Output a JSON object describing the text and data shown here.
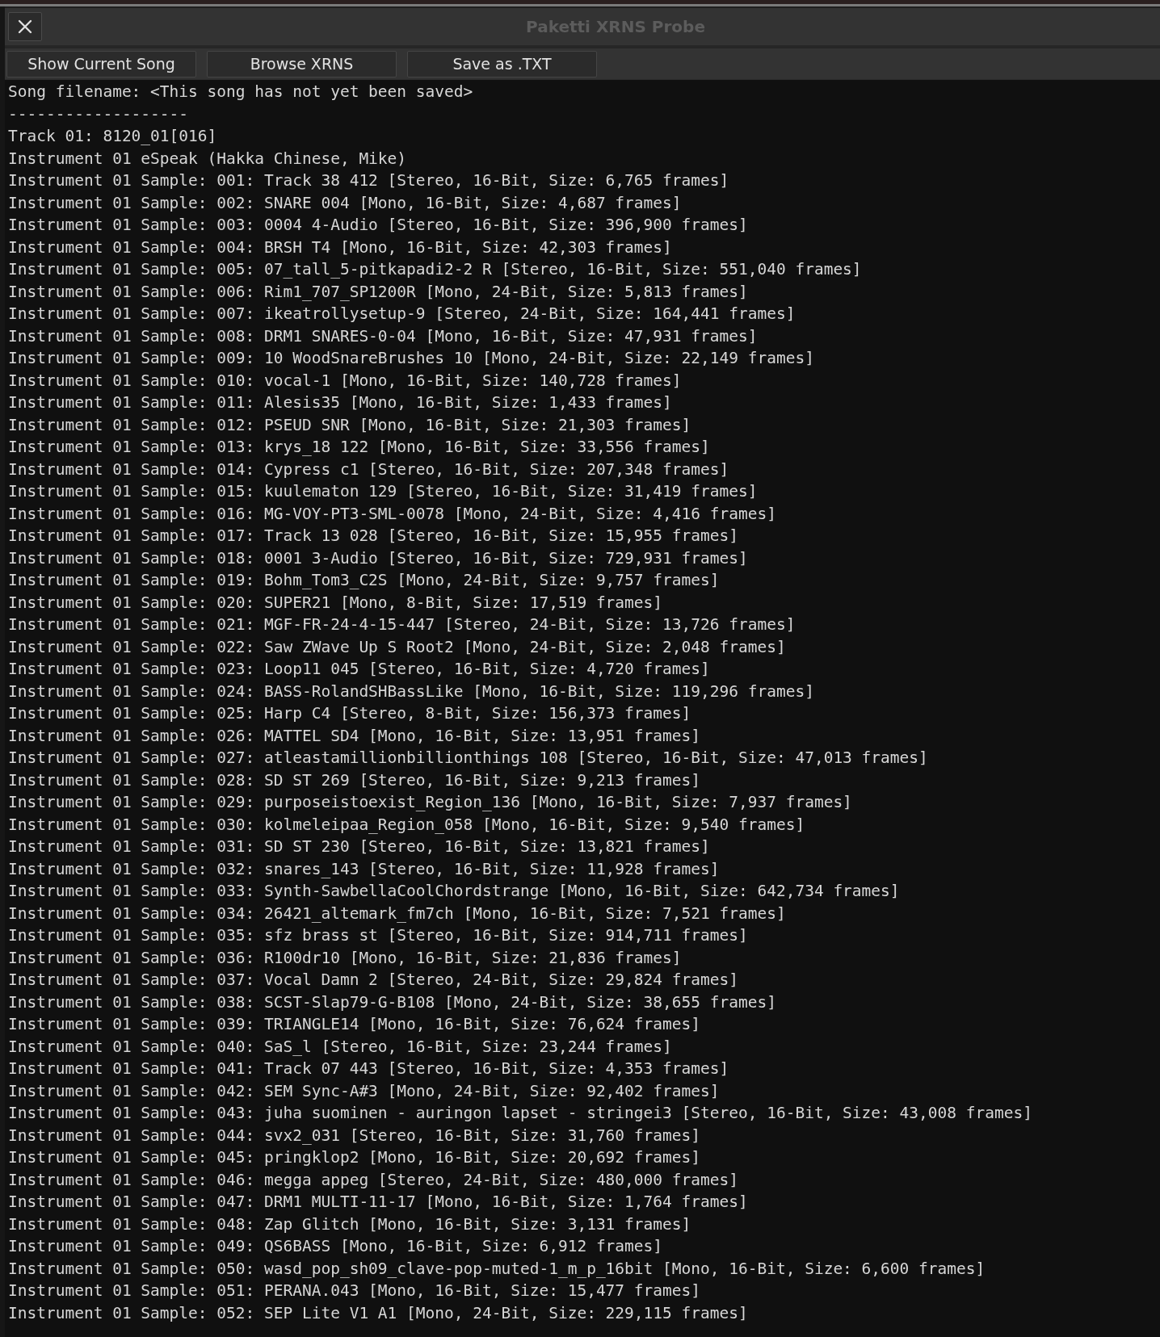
{
  "window": {
    "title": "Paketti XRNS Probe"
  },
  "buttons": [
    "Show Current Song",
    "Browse XRNS",
    "Save as .TXT"
  ],
  "output": {
    "lines": [
      "Song filename: <This song has not yet been saved>",
      "-------------------",
      "Track 01: 8120_01[016]",
      "Instrument 01 eSpeak (Hakka Chinese, Mike)",
      "Instrument 01 Sample: 001: Track 38 412 [Stereo, 16-Bit, Size: 6,765 frames]",
      "Instrument 01 Sample: 002: SNARE 004 [Mono, 16-Bit, Size: 4,687 frames]",
      "Instrument 01 Sample: 003: 0004 4-Audio [Stereo, 16-Bit, Size: 396,900 frames]",
      "Instrument 01 Sample: 004: BRSH T4 [Mono, 16-Bit, Size: 42,303 frames]",
      "Instrument 01 Sample: 005: 07_tall_5-pitkapadi2-2 R [Stereo, 16-Bit, Size: 551,040 frames]",
      "Instrument 01 Sample: 006: Rim1_707_SP1200R [Mono, 24-Bit, Size: 5,813 frames]",
      "Instrument 01 Sample: 007: ikeatrollysetup-9 [Stereo, 24-Bit, Size: 164,441 frames]",
      "Instrument 01 Sample: 008: DRM1 SNARES-0-04 [Mono, 16-Bit, Size: 47,931 frames]",
      "Instrument 01 Sample: 009: 10 WoodSnareBrushes 10 [Mono, 24-Bit, Size: 22,149 frames]",
      "Instrument 01 Sample: 010: vocal-1 [Mono, 16-Bit, Size: 140,728 frames]",
      "Instrument 01 Sample: 011: Alesis35 [Mono, 16-Bit, Size: 1,433 frames]",
      "Instrument 01 Sample: 012: PSEUD SNR [Mono, 16-Bit, Size: 21,303 frames]",
      "Instrument 01 Sample: 013: krys_18 122 [Mono, 16-Bit, Size: 33,556 frames]",
      "Instrument 01 Sample: 014: Cypress c1 [Stereo, 16-Bit, Size: 207,348 frames]",
      "Instrument 01 Sample: 015: kuulematon 129 [Stereo, 16-Bit, Size: 31,419 frames]",
      "Instrument 01 Sample: 016: MG-VOY-PT3-SML-0078 [Mono, 24-Bit, Size: 4,416 frames]",
      "Instrument 01 Sample: 017: Track 13 028 [Stereo, 16-Bit, Size: 15,955 frames]",
      "Instrument 01 Sample: 018: 0001 3-Audio [Stereo, 16-Bit, Size: 729,931 frames]",
      "Instrument 01 Sample: 019: Bohm_Tom3_C2S [Mono, 24-Bit, Size: 9,757 frames]",
      "Instrument 01 Sample: 020: SUPER21 [Mono, 8-Bit, Size: 17,519 frames]",
      "Instrument 01 Sample: 021: MGF-FR-24-4-15-447 [Stereo, 24-Bit, Size: 13,726 frames]",
      "Instrument 01 Sample: 022: Saw ZWave Up S Root2 [Mono, 24-Bit, Size: 2,048 frames]",
      "Instrument 01 Sample: 023: Loop11 045 [Stereo, 16-Bit, Size: 4,720 frames]",
      "Instrument 01 Sample: 024: BASS-RolandSHBassLike [Mono, 16-Bit, Size: 119,296 frames]",
      "Instrument 01 Sample: 025: Harp C4 [Stereo, 8-Bit, Size: 156,373 frames]",
      "Instrument 01 Sample: 026: MATTEL SD4 [Mono, 16-Bit, Size: 13,951 frames]",
      "Instrument 01 Sample: 027: atleastamillionbillionthings 108 [Stereo, 16-Bit, Size: 47,013 frames]",
      "Instrument 01 Sample: 028: SD ST 269 [Stereo, 16-Bit, Size: 9,213 frames]",
      "Instrument 01 Sample: 029: purposeistoexist_Region_136 [Mono, 16-Bit, Size: 7,937 frames]",
      "Instrument 01 Sample: 030: kolmeleipaa_Region_058 [Mono, 16-Bit, Size: 9,540 frames]",
      "Instrument 01 Sample: 031: SD ST 230 [Stereo, 16-Bit, Size: 13,821 frames]",
      "Instrument 01 Sample: 032: snares_143 [Stereo, 16-Bit, Size: 11,928 frames]",
      "Instrument 01 Sample: 033: Synth-SawbellaCoolChordstrange [Mono, 16-Bit, Size: 642,734 frames]",
      "Instrument 01 Sample: 034: 26421_altemark_fm7ch [Mono, 16-Bit, Size: 7,521 frames]",
      "Instrument 01 Sample: 035: sfz brass st [Stereo, 16-Bit, Size: 914,711 frames]",
      "Instrument 01 Sample: 036: R100dr10 [Mono, 16-Bit, Size: 21,836 frames]",
      "Instrument 01 Sample: 037: Vocal Damn 2 [Stereo, 24-Bit, Size: 29,824 frames]",
      "Instrument 01 Sample: 038: SCST-Slap79-G-B108 [Mono, 24-Bit, Size: 38,655 frames]",
      "Instrument 01 Sample: 039: TRIANGLE14 [Mono, 16-Bit, Size: 76,624 frames]",
      "Instrument 01 Sample: 040: SaS_l [Stereo, 16-Bit, Size: 23,244 frames]",
      "Instrument 01 Sample: 041: Track 07 443 [Stereo, 16-Bit, Size: 4,353 frames]",
      "Instrument 01 Sample: 042: SEM Sync-A#3 [Mono, 24-Bit, Size: 92,402 frames]",
      "Instrument 01 Sample: 043: juha suominen - auringon lapset - stringei3 [Stereo, 16-Bit, Size: 43,008 frames]",
      "Instrument 01 Sample: 044: svx2_031 [Stereo, 16-Bit, Size: 31,760 frames]",
      "Instrument 01 Sample: 045: pringklop2 [Mono, 16-Bit, Size: 20,692 frames]",
      "Instrument 01 Sample: 046: megga appeg [Stereo, 24-Bit, Size: 480,000 frames]",
      "Instrument 01 Sample: 047: DRM1 MULTI-11-17 [Mono, 16-Bit, Size: 1,764 frames]",
      "Instrument 01 Sample: 048: Zap Glitch [Mono, 16-Bit, Size: 3,131 frames]",
      "Instrument 01 Sample: 049: QS6BASS [Mono, 16-Bit, Size: 6,912 frames]",
      "Instrument 01 Sample: 050: wasd_pop_sh09_clave-pop-muted-1_m_p_16bit [Mono, 16-Bit, Size: 6,600 frames]",
      "Instrument 01 Sample: 051: PERANA.043 [Mono, 16-Bit, Size: 15,477 frames]",
      "Instrument 01 Sample: 052: SEP Lite V1 A1 [Mono, 24-Bit, Size: 229,115 frames]"
    ]
  }
}
